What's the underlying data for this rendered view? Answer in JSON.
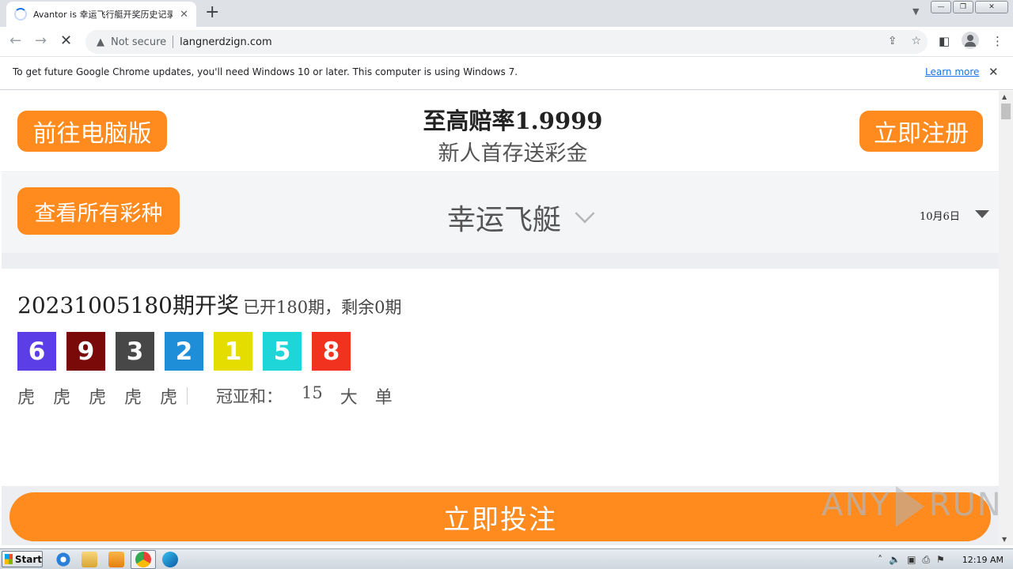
{
  "browser": {
    "tab_title": "Avantor is 幸运飞行艇开奖历史记录",
    "tab_close": "✕",
    "new_tab": "+",
    "not_secure": "Not secure",
    "url": "langnerdzign.com",
    "infobar_text": "To get future Google Chrome updates, you'll need Windows 10 or later. This computer is using Windows 7.",
    "infobar_link": "Learn more"
  },
  "header": {
    "pc_button": "前往电脑版",
    "promo_line1": "至高赔率1.9999",
    "promo_line2": "新人首存送彩金",
    "register_button": "立即注册"
  },
  "selector": {
    "all_button": "查看所有彩种",
    "lottery_name": "幸运飞艇",
    "date": "10月6日"
  },
  "result": {
    "issue": "20231005180期开奖",
    "summary": "已开180期，剩余0期",
    "numbers": [
      {
        "value": "6",
        "color": "#5b3ee6"
      },
      {
        "value": "9",
        "color": "#7a0a0a"
      },
      {
        "value": "3",
        "color": "#474747"
      },
      {
        "value": "2",
        "color": "#1e8ed9"
      },
      {
        "value": "1",
        "color": "#e6dd00"
      },
      {
        "value": "5",
        "color": "#1ed6d8"
      },
      {
        "value": "8",
        "color": "#f0321e"
      }
    ],
    "dragon_tiger": [
      "虎",
      "虎",
      "虎",
      "虎",
      "虎"
    ],
    "sum_label": "冠亚和：",
    "sum_value": "15",
    "sum_size": "大",
    "sum_parity": "单"
  },
  "footer": {
    "bet_button": "立即投注"
  },
  "watermark": {
    "left": "ANY",
    "right": "RUN"
  },
  "taskbar": {
    "start": "Start",
    "clock": "12:19 AM"
  },
  "colors": {
    "accent_orange": "#ff8a1e"
  }
}
